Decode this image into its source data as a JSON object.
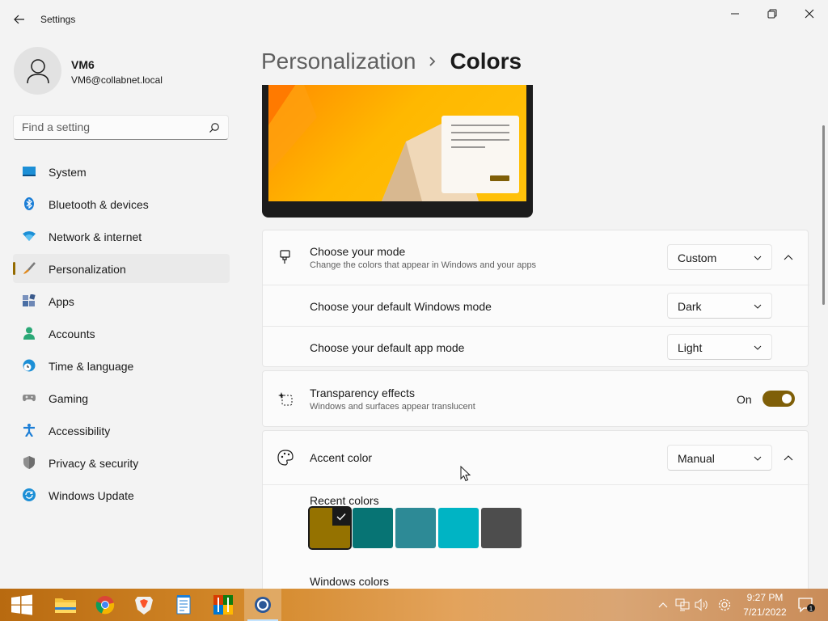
{
  "window": {
    "app_title": "Settings"
  },
  "profile": {
    "name": "VM6",
    "email": "VM6@collabnet.local"
  },
  "search": {
    "placeholder": "Find a setting"
  },
  "sidebar": {
    "items": [
      {
        "label": "System",
        "icon": "monitor-icon"
      },
      {
        "label": "Bluetooth & devices",
        "icon": "bluetooth-icon"
      },
      {
        "label": "Network & internet",
        "icon": "wifi-icon"
      },
      {
        "label": "Personalization",
        "icon": "paintbrush-icon",
        "selected": true
      },
      {
        "label": "Apps",
        "icon": "apps-icon"
      },
      {
        "label": "Accounts",
        "icon": "person-icon"
      },
      {
        "label": "Time & language",
        "icon": "clock-globe-icon"
      },
      {
        "label": "Gaming",
        "icon": "gamepad-icon"
      },
      {
        "label": "Accessibility",
        "icon": "accessibility-icon"
      },
      {
        "label": "Privacy & security",
        "icon": "shield-icon"
      },
      {
        "label": "Windows Update",
        "icon": "update-icon"
      }
    ]
  },
  "breadcrumb": {
    "parent": "Personalization",
    "current": "Colors"
  },
  "mode": {
    "title": "Choose your mode",
    "subtitle": "Change the colors that appear in Windows and your apps",
    "value": "Custom",
    "windows_mode_label": "Choose your default Windows mode",
    "windows_mode_value": "Dark",
    "app_mode_label": "Choose your default app mode",
    "app_mode_value": "Light"
  },
  "transparency": {
    "title": "Transparency effects",
    "subtitle": "Windows and surfaces appear translucent",
    "state_label": "On"
  },
  "accent": {
    "title": "Accent color",
    "value": "Manual",
    "recent_label": "Recent colors",
    "recent_colors": [
      "#957200",
      "#077474",
      "#2d8a96",
      "#00b4c4",
      "#4d4d4d"
    ],
    "windows_colors_label": "Windows colors"
  },
  "colors": {
    "accent": "#7f5f08",
    "selected_indicator": "#946b00"
  },
  "taskbar": {
    "apps": [
      "start-icon",
      "file-explorer-icon",
      "chrome-icon",
      "brave-icon",
      "notepad-icon",
      "colorful-app-icon",
      "settings-app-icon"
    ],
    "time": "9:27 PM",
    "date": "7/21/2022"
  }
}
